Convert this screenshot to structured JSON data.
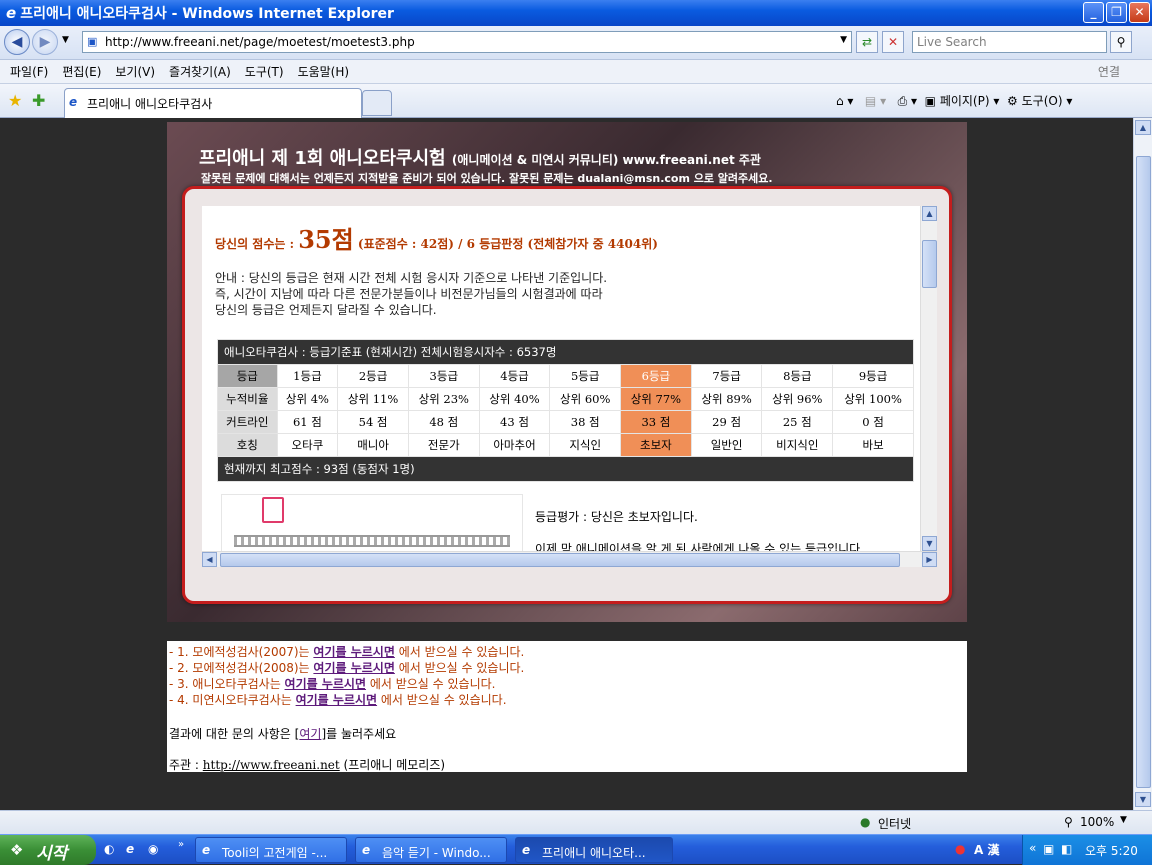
{
  "window": {
    "title": "프리애니 애니오타쿠검사 - Windows Internet Explorer",
    "icon": "ie-icon"
  },
  "toolbar": {
    "url": "http://www.freeani.net/page/moetest/moetest3.php",
    "search_placeholder": "Live Search"
  },
  "menu": {
    "items": [
      "파일(F)",
      "편집(E)",
      "보기(V)",
      "즐겨찾기(A)",
      "도구(T)",
      "도움말(H)"
    ],
    "right": "연결"
  },
  "tabs": {
    "active": "프리애니 애니오타쿠검사",
    "page_label": "페이지(P)",
    "tools_label": "도구(O)"
  },
  "page": {
    "header_title": "프리애니 제 1회 애니오타쿠시험",
    "header_sub": "(애니메이션 & 미연시 커뮤니티) www.freeani.net 주관",
    "header_note": "잘못된 문제에 대해서는 언제든지 지적받을 준비가 되어 있습니다.  잘못된 문제는 dualani@msn.com 으로 알려주세요.",
    "score_prefix": "당신의 점수는 :",
    "score_value": "35점",
    "score_suffix": "(표준점수 : 42점) / 6 등급판정 (전체참가자 중 4404위)",
    "notice_lines": [
      "안내 : 당신의 등급은 현재 시간 전체 시험 응시자 기준으로 나타낸 기준입니다.",
      "즉, 시간이 지남에 따라 다른 전문가분들이나 비전문가님들의 시험결과에 따라",
      "당신의 등급은 언제든지 달라질 수 있습니다."
    ],
    "table_title": "애니오타쿠검사 : 등급기준표 (현재시간) 전체시험응시자수 : 6537명",
    "table_rows": [
      {
        "label": "등급",
        "cells": [
          "1등급",
          "2등급",
          "3등급",
          "4등급",
          "5등급",
          "6등급",
          "7등급",
          "8등급",
          "9등급"
        ]
      },
      {
        "label": "누적비율",
        "cells": [
          "상위 4%",
          "상위 11%",
          "상위 23%",
          "상위 40%",
          "상위 60%",
          "상위 77%",
          "상위 89%",
          "상위 96%",
          "상위 100%"
        ]
      },
      {
        "label": "커트라인",
        "cells": [
          "61 점",
          "54 점",
          "48 점",
          "43 점",
          "38 점",
          "33 점",
          "29 점",
          "25 점",
          "0 점"
        ]
      },
      {
        "label": "호칭",
        "cells": [
          "오타쿠",
          "매니아",
          "전문가",
          "아마추어",
          "지식인",
          "초보자",
          "일반인",
          "비지식인",
          "바보"
        ]
      }
    ],
    "highlight_grade": "6등급",
    "highlight_color": "#f08f57",
    "table_footer": "현재까지 최고점수 : 93점 (동점자 1명)",
    "eval1": "등급평가 : 당신은 초보자입니다.",
    "eval2": "이제 막 애니메이션을 알 게 된 사람에게 나올 수 있는 등급입니다."
  },
  "links": [
    {
      "prefix": "- 1. 모에적성검사(2007)는 ",
      "link": "여기를 누르시면",
      "suffix": " 에서 받으실 수 있습니다."
    },
    {
      "prefix": "- 2. 모에적성검사(2008)는 ",
      "link": "여기를 누르시면",
      "suffix": " 에서 받으실 수 있습니다."
    },
    {
      "prefix": "- 3. 애니오타쿠검사는 ",
      "link": "여기를 누르시면",
      "suffix": " 에서 받으실 수 있습니다."
    },
    {
      "prefix": "- 4. 미연시오타쿠검사는 ",
      "link": "여기를 누르시면",
      "suffix": " 에서 받으실 수 있습니다."
    }
  ],
  "contact": {
    "prefix": "결과에 대한 문의 사항은 [",
    "link": "여기",
    "suffix": "]를 눌러주세요"
  },
  "host": {
    "prefix": "주관 : ",
    "link": "http://www.freeani.net",
    "suffix": " (프리애니 메모리즈)"
  },
  "status": {
    "zone": "인터넷",
    "zoom": "100%"
  },
  "taskbar": {
    "start": "시작",
    "tasks": [
      "Tooli의 고전게임 -...",
      "음악 듣기 - Windo...",
      "프리애니 애니오타..."
    ],
    "clock": "오후 5:20"
  },
  "colors": {
    "accent_red": "#c41d1d",
    "score_color": "#b33a00",
    "link_color": "#5d1a7b"
  }
}
